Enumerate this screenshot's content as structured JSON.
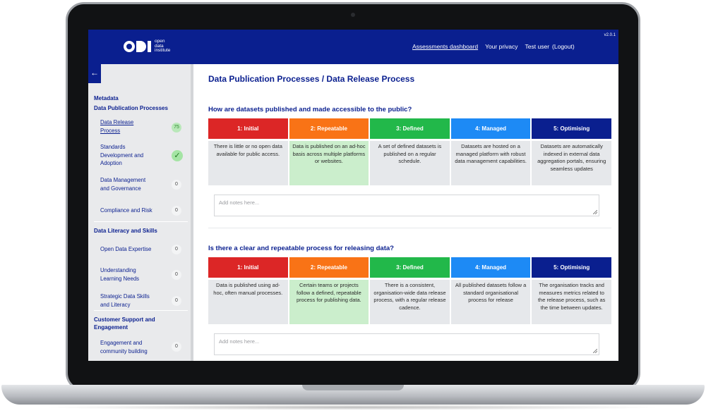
{
  "header": {
    "logo_text": [
      "open",
      "data",
      "institute"
    ],
    "version": "v2.0.1",
    "nav": [
      "Assessments dashboard",
      "Your privacy",
      "Test user",
      "(Logout)"
    ]
  },
  "sidebar": {
    "back_glyph": "←",
    "top_section": "Metadata",
    "sections": [
      {
        "title": "Data Publication Processes",
        "items": [
          {
            "label": [
              "Data Release",
              "Process"
            ],
            "badge": "75",
            "status": "in-progress",
            "active": true
          },
          {
            "label": [
              "Standards",
              "Development and",
              "Adoption"
            ],
            "badge": "✓",
            "status": "complete"
          },
          {
            "label": [
              "Data Management",
              "and Governance"
            ],
            "badge": "0",
            "status": "none"
          },
          {
            "label": [
              "Compliance and Risk"
            ],
            "badge": "0",
            "status": "none"
          }
        ]
      },
      {
        "title": "Data Literacy and Skills",
        "items": [
          {
            "label": [
              "Open Data Expertise"
            ],
            "badge": "0",
            "status": "none"
          },
          {
            "label": [
              "Understanding",
              "Learning Needs"
            ],
            "badge": "0",
            "status": "none"
          },
          {
            "label": [
              "Strategic Data Skills",
              "and Literacy"
            ],
            "badge": "0",
            "status": "none"
          }
        ]
      },
      {
        "title": [
          "Customer Support and",
          "Engagement"
        ],
        "items": [
          {
            "label": [
              "Engagement and",
              "community building"
            ],
            "badge": "0",
            "status": "none"
          }
        ]
      }
    ]
  },
  "main": {
    "page_title": "Data Publication Processes / Data Release Process",
    "levels": [
      {
        "label": "1: Initial",
        "color": "#dc2626"
      },
      {
        "label": "2: Repeatable",
        "color": "#f97316"
      },
      {
        "label": "3: Defined",
        "color": "#22b84a"
      },
      {
        "label": "4: Managed",
        "color": "#1d8af5"
      },
      {
        "label": "5: Optimising",
        "color": "#0a1f8f"
      }
    ],
    "questions": [
      {
        "text": "How are datasets published and made accessible to the public?",
        "selected_level": 2,
        "descriptions": [
          "There is little or no open data available for public access.",
          "Data is published on an ad-hoc basis across multiple platforms or websites.",
          "A set of defined datasets is published on a regular schedule.",
          "Datasets are hosted on a managed platform with robust data management capabilities.",
          "Datasets are automatically indexed in external data aggregation portals, ensuring seamless updates"
        ],
        "notes_placeholder": "Add notes here..."
      },
      {
        "text": "Is there a clear and repeatable process for releasing data?",
        "selected_level": 2,
        "descriptions": [
          "Data is published using ad-hoc, often manual processes.",
          "Certain teams or projects follow a defined, repeatable process for publishing data.",
          "There is a consistent, organisation-wide data release process, with a regular release cadence.",
          "All published datasets follow a standard organisational process for release",
          "The organisation tracks and measures metrics related to the release process, such as the time between updates."
        ],
        "notes_placeholder": "Add notes here..."
      }
    ]
  }
}
